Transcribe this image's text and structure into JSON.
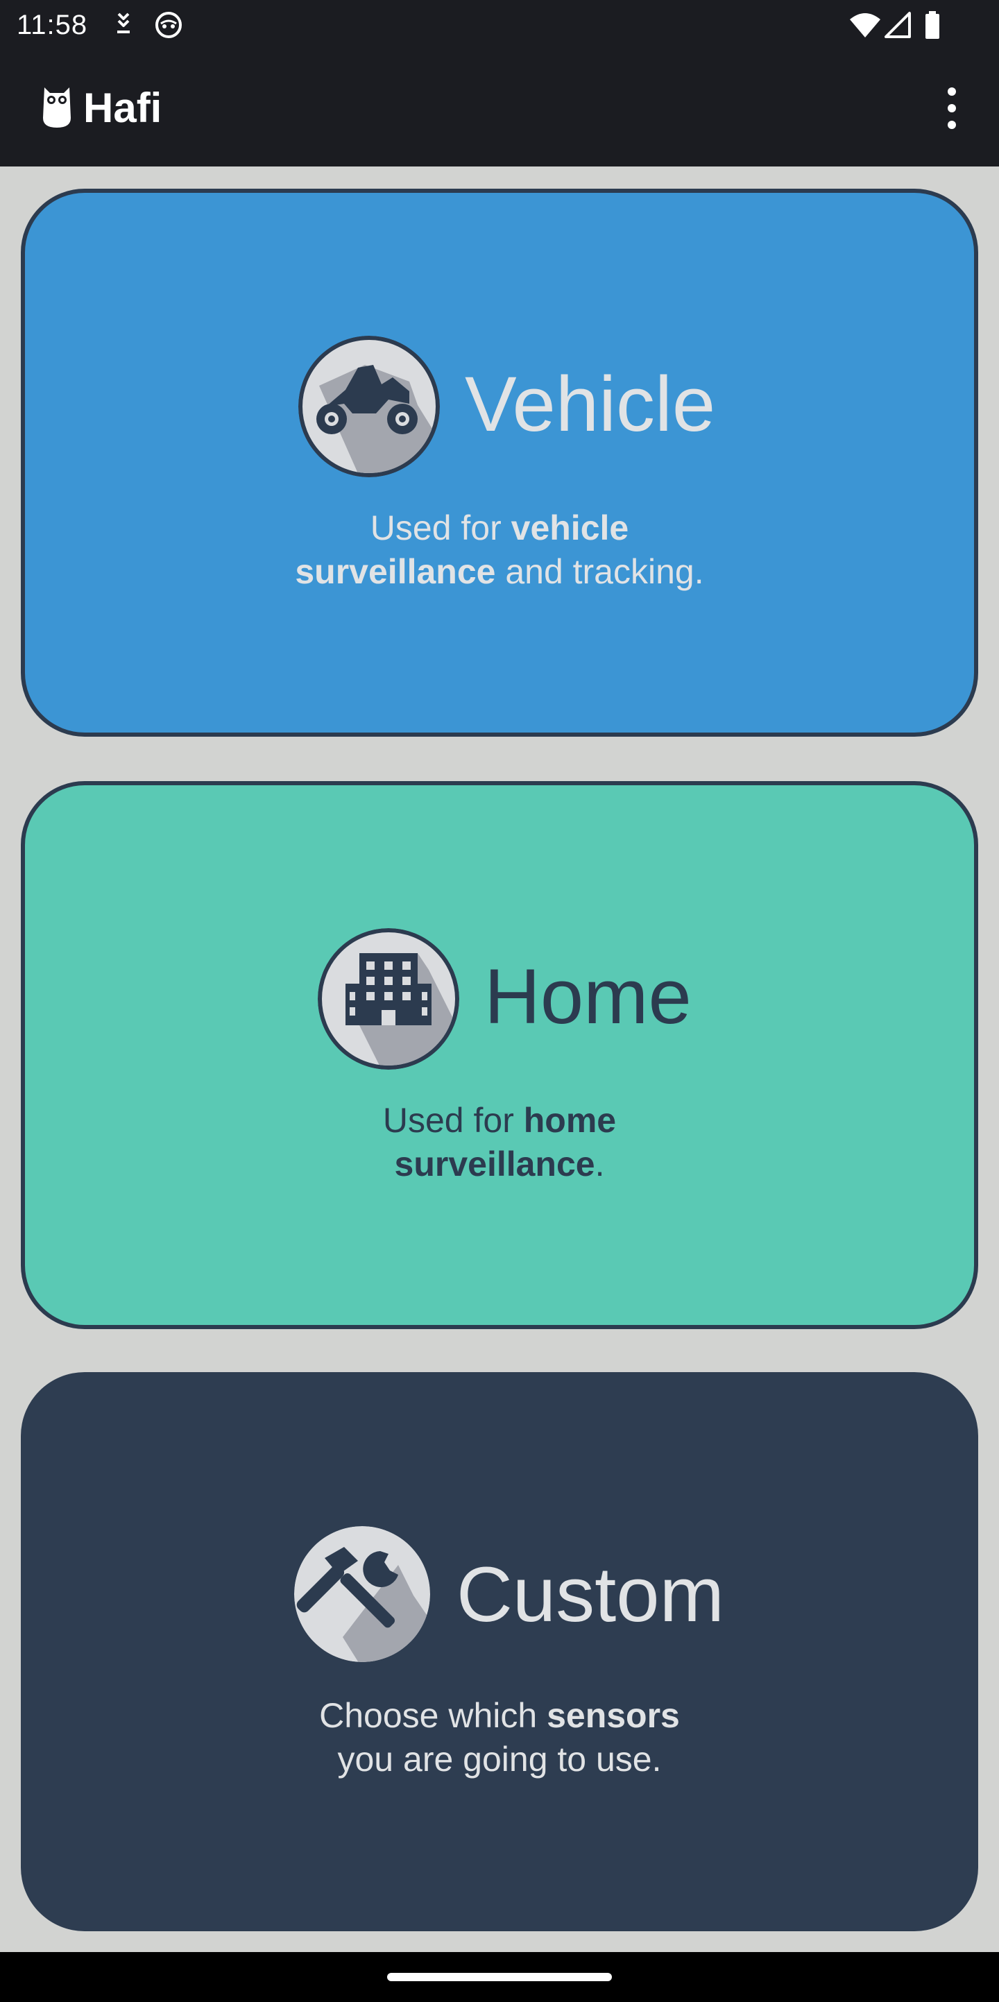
{
  "status_bar": {
    "time": "11:58"
  },
  "app_bar": {
    "title": "Hafi",
    "logo_icon": "owl-icon",
    "menu_icon": "more-vert-icon"
  },
  "cards": {
    "vehicle": {
      "title": "Vehicle",
      "icon": "motorcycle-icon",
      "desc_line1_pre": "Used for ",
      "desc_line1_bold": "vehicle",
      "desc_line2_bold": "surveillance",
      "desc_line2_post": " and tracking.",
      "background": "#3c95d4"
    },
    "home": {
      "title": "Home",
      "icon": "building-icon",
      "desc_line1_pre": "Used for ",
      "desc_line1_bold": "home",
      "desc_line2_bold": "surveillance",
      "desc_line2_post": ".",
      "background": "#5ac9b4"
    },
    "custom": {
      "title": "Custom",
      "icon": "tools-icon",
      "desc_line1_pre": "Choose which ",
      "desc_line1_bold": "sensors",
      "desc_line2_text": "you are going to use.",
      "background": "#2e3d51"
    }
  },
  "colors": {
    "page_background": "#d2d3d1",
    "bar_background": "#1b1c21",
    "card_border": "#2c3b4f",
    "light_text": "#e1e3e5",
    "dark_text": "#2c3b4f"
  }
}
